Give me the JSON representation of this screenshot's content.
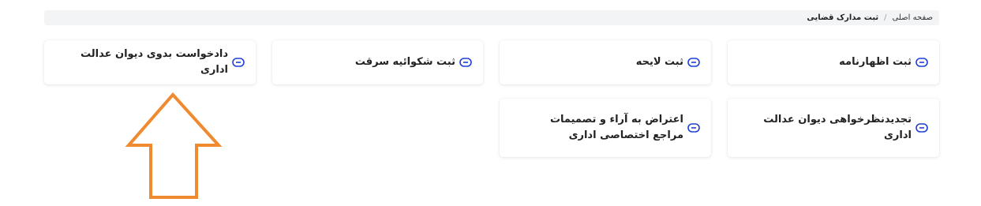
{
  "breadcrumb": {
    "home": "صفحه اصلی",
    "separator": "/",
    "current": "ثبت مدارک قضایی"
  },
  "cards": [
    {
      "label": "ثبت اظهارنامه"
    },
    {
      "label": "ثبت لایحه"
    },
    {
      "label": "ثبت شکوائیه سرقت"
    },
    {
      "label": "دادخواست بدوی دیوان عدالت اداری"
    },
    {
      "label": "تجدیدنظرخواهی دیوان عدالت اداری"
    },
    {
      "label": "اعتراض به آراء و تصمیمات مراجع اختصاصی اداری"
    }
  ],
  "icon": "link-icon",
  "colors": {
    "accent": "#1e40d6",
    "annotation_arrow": "#f08a30",
    "breadcrumb_bg": "#f3f4f6"
  }
}
